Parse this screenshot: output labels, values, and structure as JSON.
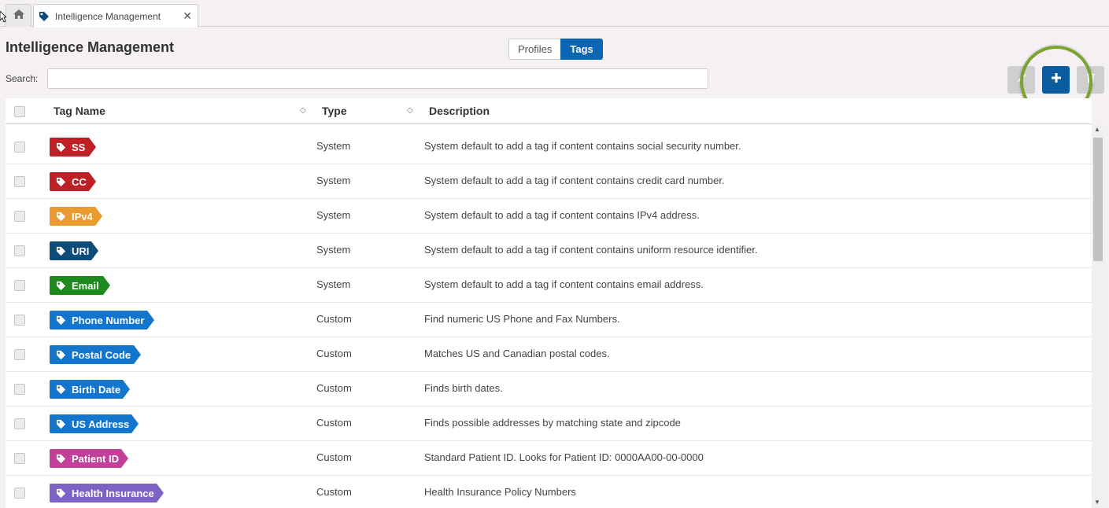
{
  "tabs": {
    "home_icon": "home-icon",
    "active_tab_label": "Intelligence Management",
    "close_glyph": "✕"
  },
  "header": {
    "title": "Intelligence Management",
    "segment": {
      "profiles_label": "Profiles",
      "tags_label": "Tags",
      "selected": "Tags"
    }
  },
  "search": {
    "label": "Search:",
    "value": "",
    "placeholder": ""
  },
  "toolbar": {
    "edit_icon": "pencil-icon",
    "add_icon": "plus-icon",
    "delete_icon": "trash-icon",
    "add_glyph": "+"
  },
  "table": {
    "columns": {
      "tag_name": "Tag Name",
      "type": "Type",
      "description": "Description"
    },
    "rows": [
      {
        "tag": "SS",
        "color": "#bf2026",
        "type": "System",
        "description": "System default to add a tag if content contains social security number."
      },
      {
        "tag": "CC",
        "color": "#bf2026",
        "type": "System",
        "description": "System default to add a tag if content contains credit card number."
      },
      {
        "tag": "IPv4",
        "color": "#eb9a2d",
        "type": "System",
        "description": "System default to add a tag if content contains IPv4 address."
      },
      {
        "tag": "URI",
        "color": "#0d4c78",
        "type": "System",
        "description": "System default to add a tag if content contains uniform resource identifier."
      },
      {
        "tag": "Email",
        "color": "#1e8a1e",
        "type": "System",
        "description": "System default to add a tag if content contains email address."
      },
      {
        "tag": "Phone Number",
        "color": "#1376cc",
        "type": "Custom",
        "description": "Find numeric US Phone and Fax Numbers."
      },
      {
        "tag": "Postal Code",
        "color": "#1376cc",
        "type": "Custom",
        "description": "Matches US and Canadian postal codes."
      },
      {
        "tag": "Birth Date",
        "color": "#1376cc",
        "type": "Custom",
        "description": "Finds birth dates."
      },
      {
        "tag": "US Address",
        "color": "#1376cc",
        "type": "Custom",
        "description": "Finds possible addresses by matching state and zipcode"
      },
      {
        "tag": "Patient ID",
        "color": "#c23f9a",
        "type": "Custom",
        "description": "Standard Patient ID. Looks for Patient ID: 0000AA00-00-0000"
      },
      {
        "tag": "Health Insurance",
        "color": "#7b62c4",
        "type": "Custom",
        "description": "Health Insurance Policy Numbers"
      }
    ]
  }
}
